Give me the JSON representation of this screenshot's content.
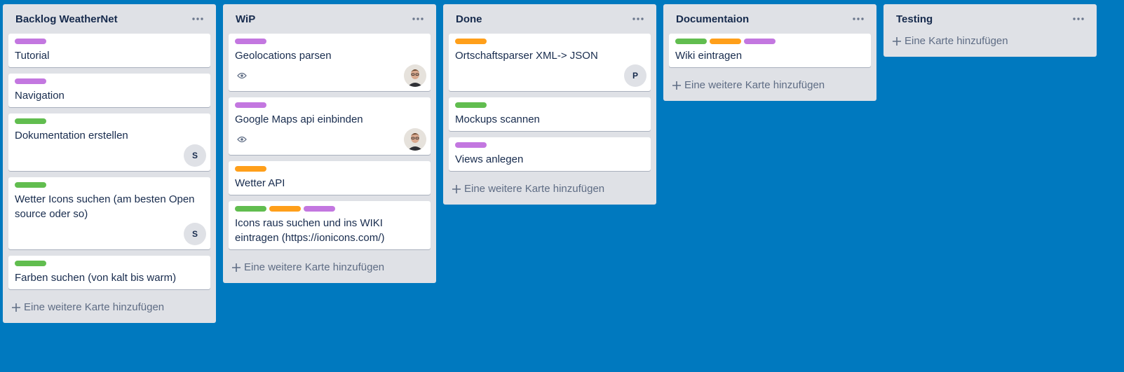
{
  "colors": {
    "board_bg": "#0079bf",
    "list_bg": "#dfe1e6",
    "purple": "#c377e0",
    "green": "#61bd4f",
    "orange": "#ff9f1a"
  },
  "lists": [
    {
      "title": "Backlog WeatherNet",
      "cards": [
        {
          "labels": [
            "purple"
          ],
          "title": "Tutorial"
        },
        {
          "labels": [
            "purple"
          ],
          "title": "Navigation"
        },
        {
          "labels": [
            "green"
          ],
          "title": "Dokumentation erstellen",
          "member": "S"
        },
        {
          "labels": [
            "green"
          ],
          "title": "Wetter Icons suchen (am besten Open source oder so)",
          "member": "S"
        },
        {
          "labels": [
            "green"
          ],
          "title": "Farben suchen (von kalt bis warm)"
        }
      ],
      "add_label": "Eine weitere Karte hinzufügen"
    },
    {
      "title": "WiP",
      "cards": [
        {
          "labels": [
            "purple"
          ],
          "title": "Geolocations parsen",
          "watch_icon": "eye-icon",
          "member_photo": "avatar"
        },
        {
          "labels": [
            "purple"
          ],
          "title": "Google Maps api einbinden",
          "watch_icon": "eye-icon",
          "member_photo": "avatar"
        },
        {
          "labels": [
            "orange"
          ],
          "title": "Wetter API"
        },
        {
          "labels": [
            "green",
            "orange",
            "purple"
          ],
          "title": "Icons raus suchen und ins WIKI eintragen (https://ionicons.com/)"
        }
      ],
      "add_label": "Eine weitere Karte hinzufügen"
    },
    {
      "title": "Done",
      "cards": [
        {
          "labels": [
            "orange"
          ],
          "title": "Ortschaftsparser XML-> JSON",
          "member": "P"
        },
        {
          "labels": [
            "green"
          ],
          "title": "Mockups scannen"
        },
        {
          "labels": [
            "purple"
          ],
          "title": "Views anlegen"
        }
      ],
      "add_label": "Eine weitere Karte hinzufügen"
    },
    {
      "title": "Documentaion",
      "cards": [
        {
          "labels": [
            "green",
            "orange",
            "purple"
          ],
          "title": "Wiki eintragen"
        }
      ],
      "add_label": "Eine weitere Karte hinzufügen"
    },
    {
      "title": "Testing",
      "cards": [],
      "add_label": "Eine Karte hinzufügen"
    }
  ],
  "icons": {
    "list_menu": "more-icon",
    "add": "plus-icon"
  }
}
